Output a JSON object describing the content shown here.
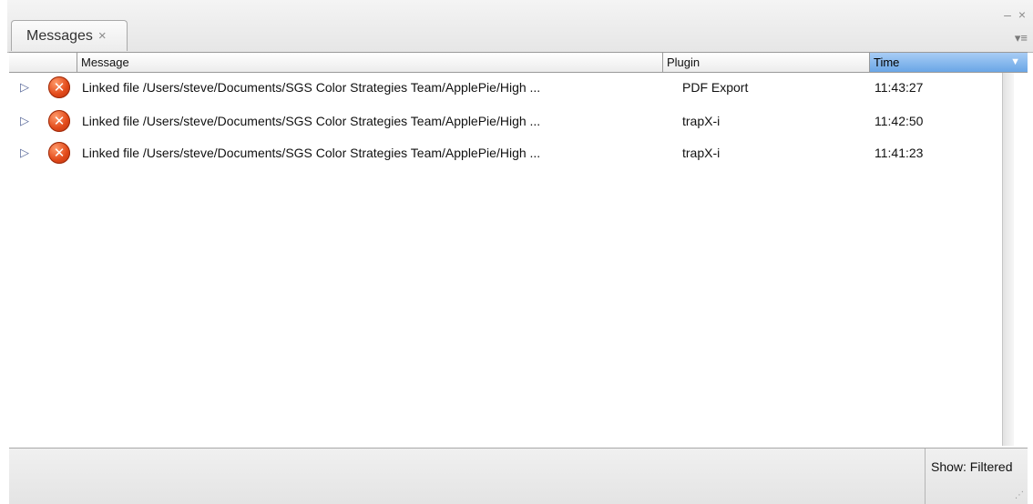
{
  "panel": {
    "tab_label": "Messages",
    "tab_close": "×",
    "window_controls": "– ×",
    "panel_menu": "▾≡"
  },
  "table": {
    "columns": [
      "Message",
      "Plugin",
      "Time"
    ],
    "sorted_column": "Time",
    "sort_indicator": "▼",
    "rows": [
      {
        "message": "Linked file /Users/steve/Documents/SGS Color Strategies Team/ApplePie/High ...",
        "plugin": "PDF Export",
        "time": "11:43:27"
      },
      {
        "message": "Linked file /Users/steve/Documents/SGS Color Strategies Team/ApplePie/High ...",
        "plugin": "trapX-i",
        "time": "11:42:50"
      },
      {
        "message": "Linked file /Users/steve/Documents/SGS Color Strategies Team/ApplePie/High ...",
        "plugin": "trapX-i",
        "time": "11:41:23"
      }
    ],
    "row_icons": {
      "disclosure": "disclosure-triangle-icon",
      "status": "error-icon"
    }
  },
  "footer": {
    "show_filter": "Show: Filtered"
  },
  "colors": {
    "selected_header": "#6aa6e6",
    "error_icon": "#e24a1a"
  }
}
